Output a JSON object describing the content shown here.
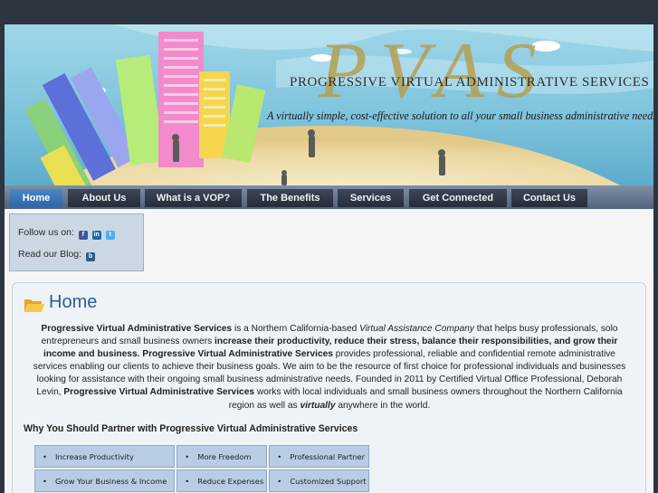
{
  "site": {
    "logo_letters": "PVAS",
    "title": "Progressive Virtual Administrative Services",
    "tagline": "A virtually simple, cost-effective solution to all your small business administrative needs"
  },
  "nav": {
    "items": [
      {
        "label": "Home",
        "active": true
      },
      {
        "label": "About Us"
      },
      {
        "label": "What is a VOP?"
      },
      {
        "label": "The Benefits"
      },
      {
        "label": "Services"
      },
      {
        "label": "Get Connected"
      },
      {
        "label": "Contact Us"
      }
    ]
  },
  "social": {
    "follow_label": "Follow us on:",
    "blog_label": "Read our Blog:",
    "icons": [
      "facebook-icon",
      "linkedin-icon",
      "twitter-icon",
      "blog-icon"
    ]
  },
  "content": {
    "heading": "Home",
    "intro": [
      {
        "text": "Progressive Virtual Administrative Services",
        "style": "b"
      },
      {
        "text": " is a Northern California-based "
      },
      {
        "text": "Virtual Assistance Company",
        "style": "i"
      },
      {
        "text": " that helps busy professionals, solo entrepreneurs and small business owners "
      },
      {
        "text": "increase their productivity, reduce their stress, balance their responsibilities, and grow their income and business.",
        "style": "b"
      },
      {
        "text": " "
      },
      {
        "text": "Progressive Virtual Administrative Services",
        "style": "b"
      },
      {
        "text": " provides professional, reliable and confidential remote administrative services enabling our clients to achieve their business goals. We aim to be the resource of first choice for professional individuals and businesses looking for assistance with their ongoing small business administrative needs.  Founded in 2011 by Certified Virtual Office Professional, Deborah Levin, "
      },
      {
        "text": "Progressive Virtual Administrative Services",
        "style": "b"
      },
      {
        "text": " works with local individuals and small business owners throughout the Northern California region as well as "
      },
      {
        "text": "virtually",
        "style": "bi"
      },
      {
        "text": " anywhere in the world."
      }
    ],
    "why_heading": "Why You Should Partner with Progressive Virtual Administrative Services",
    "bullet": "•",
    "benefits": [
      [
        "Increase Productivity",
        "More Freedom",
        "Professional Partner"
      ],
      [
        "Grow Your Business & Income",
        "Reduce Expenses",
        "Customized Support"
      ]
    ]
  },
  "colors": {
    "accent": "#2b5c98",
    "nav_active": "#3a78bc",
    "nav_bg": "#2e3645",
    "table_cell": "#b8cde4"
  }
}
